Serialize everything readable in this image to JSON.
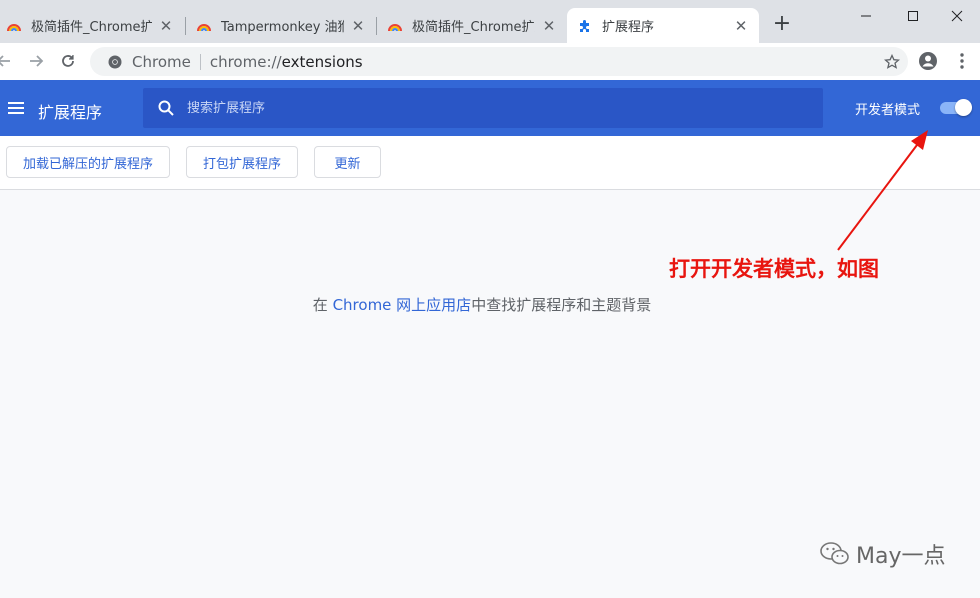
{
  "tabs": [
    {
      "title": "极简插件_Chrome扩展插件",
      "active": false
    },
    {
      "title": "Tampermonkey 油猴脚本",
      "active": false
    },
    {
      "title": "极简插件_Chrome扩展插件",
      "active": false
    },
    {
      "title": "扩展程序",
      "active": true
    }
  ],
  "toolbar": {
    "site_label": "Chrome",
    "url_scheme": "chrome://",
    "url_host": "extensions"
  },
  "header": {
    "title": "扩展程序",
    "search_placeholder": "搜索扩展程序",
    "dev_mode_label": "开发者模式",
    "dev_mode_on": true
  },
  "actions": {
    "load_unpacked": "加载已解压的扩展程序",
    "pack": "打包扩展程序",
    "update": "更新"
  },
  "main": {
    "prefix": "在 ",
    "store_link": "Chrome 网上应用店",
    "suffix": "中查找扩展程序和主题背景"
  },
  "annotation": {
    "text": "打开开发者模式，如图",
    "color": "#e8150f"
  },
  "watermark": {
    "text": "May一点"
  },
  "colors": {
    "header_bg": "#3367d6",
    "search_bg": "#2a56c6",
    "link": "#3367d6",
    "tabstrip_bg": "#dee1e6"
  }
}
